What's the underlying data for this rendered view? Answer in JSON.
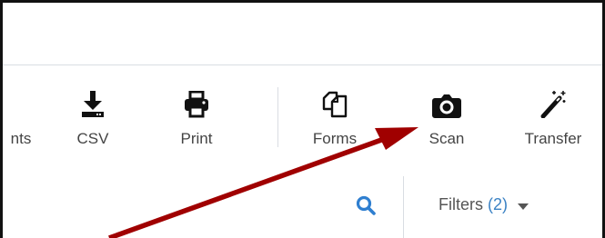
{
  "toolbar": {
    "items": [
      {
        "label": "nts",
        "icon": "clipped-tool-icon"
      },
      {
        "label": "CSV",
        "icon": "download-csv-icon"
      },
      {
        "label": "Print",
        "icon": "printer-icon"
      },
      {
        "label": "Forms",
        "icon": "forms-copy-icon"
      },
      {
        "label": "Scan",
        "icon": "camera-icon"
      },
      {
        "label": "Transfer",
        "icon": "magic-wand-icon"
      }
    ]
  },
  "filterbar": {
    "search_icon": "search-icon",
    "filters_label": "Filters",
    "filters_count": "(2)",
    "caret_icon": "caret-down-icon"
  },
  "annotation": {
    "arrow_color": "#a00000",
    "points_to": "Scan"
  },
  "colors": {
    "accent": "#2f7fd0",
    "icon": "#111111",
    "text": "#444444",
    "divider": "#d9dde3"
  }
}
